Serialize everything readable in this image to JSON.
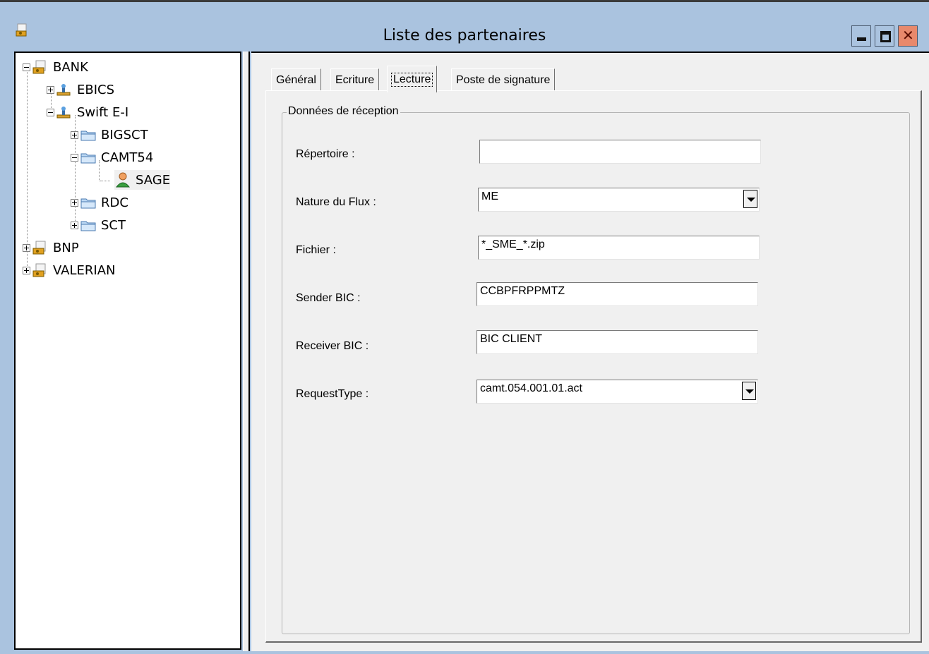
{
  "window": {
    "title": "Liste des partenaires"
  },
  "tree": {
    "items": [
      {
        "label": "BANK",
        "icon": "bank-icon",
        "expanded": true
      },
      {
        "label": "EBICS",
        "icon": "protocol-icon",
        "expanded": false
      },
      {
        "label": "Swift E-I",
        "icon": "protocol-icon",
        "expanded": true
      },
      {
        "label": "BIGSCT",
        "icon": "folder-icon",
        "expanded": false
      },
      {
        "label": "CAMT54",
        "icon": "folder-icon",
        "expanded": true
      },
      {
        "label": "SAGE",
        "icon": "user-icon",
        "selected": true
      },
      {
        "label": "RDC",
        "icon": "folder-icon",
        "expanded": false
      },
      {
        "label": "SCT",
        "icon": "folder-icon",
        "expanded": false
      },
      {
        "label": "BNP",
        "icon": "bank-icon",
        "expanded": false
      },
      {
        "label": "VALERIAN",
        "icon": "bank-icon",
        "expanded": false
      }
    ]
  },
  "tabs": [
    {
      "label": "Général"
    },
    {
      "label": "Ecriture"
    },
    {
      "label": "Lecture",
      "active": true
    },
    {
      "label": "Poste de signature"
    }
  ],
  "group": {
    "title": "Données de réception"
  },
  "fields": {
    "repertoire": {
      "label": "Répertoire :",
      "value": ""
    },
    "nature_flux": {
      "label": "Nature du Flux :",
      "value": "ME"
    },
    "fichier": {
      "label": "Fichier :",
      "value": "*_SME_*.zip"
    },
    "sender_bic": {
      "label": "Sender BIC :",
      "value": "CCBPFRPPMTZ"
    },
    "receiver_bic": {
      "label": "Receiver BIC :",
      "value": "BIC CLIENT"
    },
    "request_type": {
      "label": "RequestType :",
      "value": "camt.054.001.01.act"
    }
  },
  "colors": {
    "chrome": "#aac3df",
    "panel": "#f0f0f0",
    "close": "#e8896c"
  }
}
